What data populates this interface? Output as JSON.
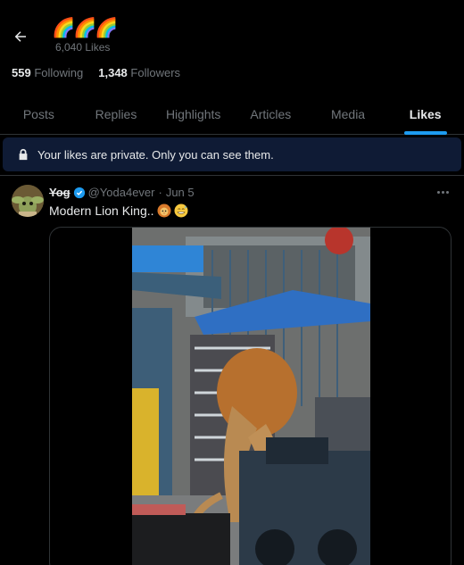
{
  "header": {
    "back_icon": "arrow-left-icon",
    "name_emoji": "🌈🌈🌈",
    "likes_count_label": "6,040 Likes"
  },
  "profile": {
    "following_count": "559",
    "following_label": "Following",
    "followers_count": "1,348",
    "followers_label": "Followers"
  },
  "tabs": [
    {
      "label": "Posts",
      "active": false
    },
    {
      "label": "Replies",
      "active": false
    },
    {
      "label": "Highlights",
      "active": false
    },
    {
      "label": "Articles",
      "active": false
    },
    {
      "label": "Media",
      "active": false
    },
    {
      "label": "Likes",
      "active": true
    }
  ],
  "notice": {
    "icon": "lock-icon",
    "text": "Your likes are private. Only you can see them."
  },
  "tweet": {
    "display_name": "Yog",
    "verified_icon": "verified-badge-icon",
    "handle": "@Yoda4ever",
    "separator": "·",
    "date": "Jun 5",
    "text": "Modern Lion King..",
    "emojis": [
      "lion-face-emoji",
      "grinning-sweat-emoji"
    ],
    "more_icon": "more-options-icon"
  },
  "colors": {
    "background": "#000000",
    "text": "#e7e9ea",
    "muted": "#71767b",
    "accent": "#1d9bf0",
    "notice_bg": "#0f1b35",
    "border": "#2f3336"
  }
}
